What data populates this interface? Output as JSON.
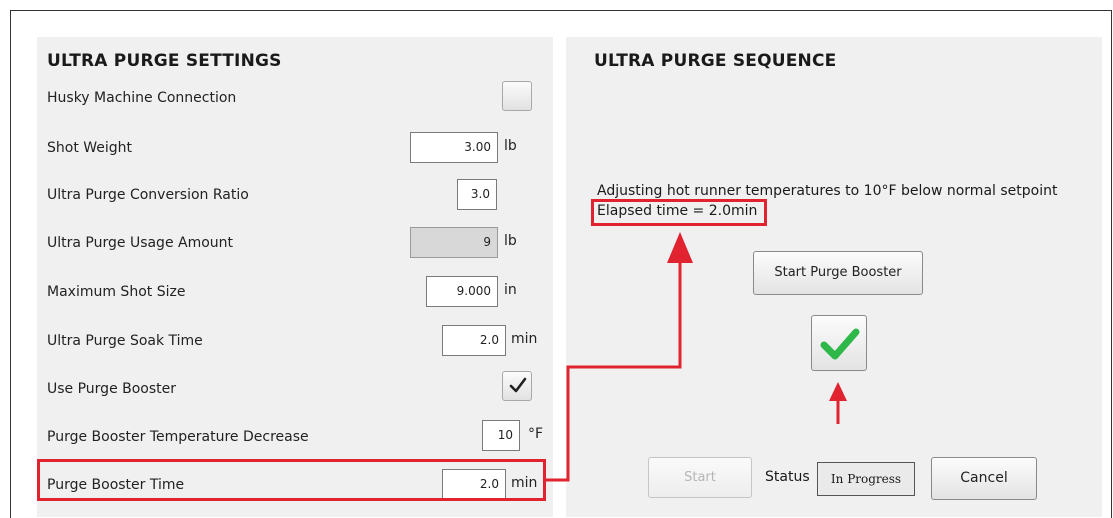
{
  "settings": {
    "title": "ULTRA PURGE SETTINGS",
    "husky_label": "Husky Machine Connection",
    "shot_weight_label": "Shot Weight",
    "shot_weight_value": "3.00",
    "shot_weight_unit": "lb",
    "conversion_label": "Ultra Purge Conversion Ratio",
    "conversion_value": "3.0",
    "usage_label": "Ultra Purge Usage Amount",
    "usage_value": "9",
    "usage_unit": "lb",
    "max_shot_label": "Maximum Shot Size",
    "max_shot_value": "9.000",
    "max_shot_unit": "in",
    "soak_label": "Ultra Purge Soak Time",
    "soak_value": "2.0",
    "soak_unit": "min",
    "use_booster_label": "Use Purge Booster",
    "temp_decrease_label": "Purge Booster Temperature Decrease",
    "temp_decrease_value": "10",
    "temp_decrease_unit": "°F",
    "booster_time_label": "Purge Booster Time",
    "booster_time_value": "2.0",
    "booster_time_unit": "min"
  },
  "sequence": {
    "title": "ULTRA PURGE SEQUENCE",
    "message": "Adjusting hot runner temperatures to 10°F below normal setpoint",
    "elapsed": "Elapsed time = 2.0min",
    "start_booster_label": "Start Purge Booster",
    "start_label": "Start",
    "status_label": "Status",
    "status_value": "In Progress",
    "cancel_label": "Cancel"
  },
  "colors": {
    "annotation_red": "#e0232e",
    "check_green": "#2fb84a"
  },
  "icons": {
    "husky_checkbox": "empty-checkbox",
    "use_booster_checkbox": "checkmark-icon",
    "booster_done": "green-checkmark-icon"
  }
}
